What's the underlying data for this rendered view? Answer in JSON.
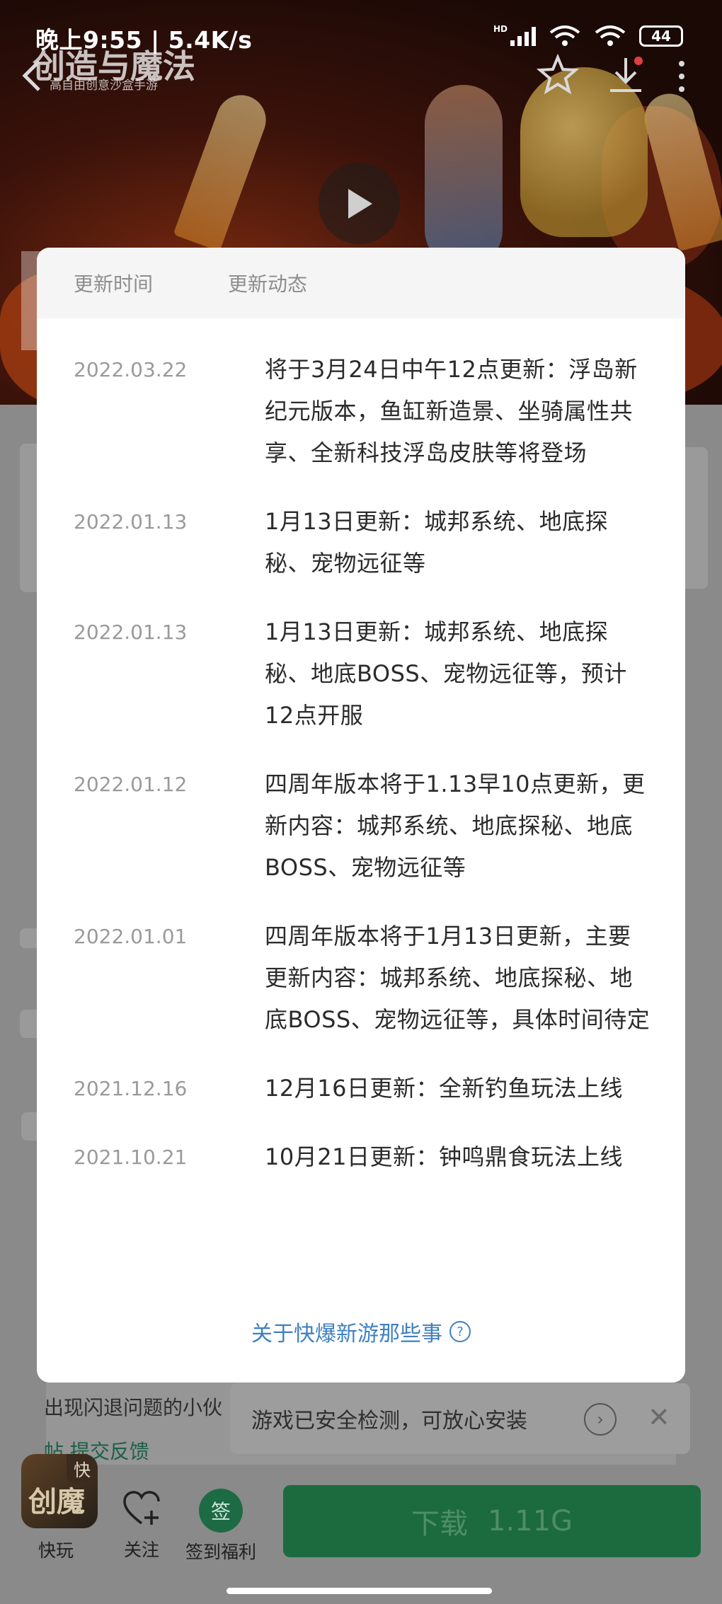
{
  "status_bar": {
    "time_speed": "晚上9:55 | 5.4K/s",
    "network_badge": "HD",
    "battery": "44"
  },
  "banner": {
    "game_logo": "创造与魔法",
    "game_tagline": "高自由创意沙盒手游"
  },
  "dialog": {
    "columns": {
      "time": "更新时间",
      "news": "更新动态"
    },
    "entries": [
      {
        "date": "2022.03.22",
        "text": "将于3月24日中午12点更新：浮岛新纪元版本，鱼缸新造景、坐骑属性共享、全新科技浮岛皮肤等将登场"
      },
      {
        "date": "2022.01.13",
        "text": "1月13日更新：城邦系统、地底探秘、宠物远征等"
      },
      {
        "date": "2022.01.13",
        "text": "1月13日更新：城邦系统、地底探秘、地底BOSS、宠物远征等，预计12点开服"
      },
      {
        "date": "2022.01.12",
        "text": "四周年版本将于1.13早10点更新，更新内容：城邦系统、地底探秘、地底BOSS、宠物远征等"
      },
      {
        "date": "2022.01.01",
        "text": "四周年版本将于1月13日更新，主要更新内容：城邦系统、地底探秘、地底BOSS、宠物远征等，具体时间待定"
      },
      {
        "date": "2021.12.16",
        "text": "12月16日更新：全新钓鱼玩法上线"
      },
      {
        "date": "2021.10.21",
        "text": "10月21日更新：钟鸣鼎食玩法上线"
      }
    ],
    "footer_link": "关于快爆新游那些事",
    "footer_icon": "question-circle-icon"
  },
  "background": {
    "crash_text": "出现闪退问题的小伙",
    "feedback_prefix": "帖",
    "feedback_link": "提交反馈",
    "security_notice": "游戏已安全检测，可放心安装"
  },
  "bottom_bar": {
    "app_badge": "快",
    "app_icon_text": "创魔",
    "quick_play": "快玩",
    "follow": "关注",
    "sign_glyph": "签",
    "sign_in": "签到福利",
    "download_label": "下载",
    "download_size": "1.11G"
  }
}
